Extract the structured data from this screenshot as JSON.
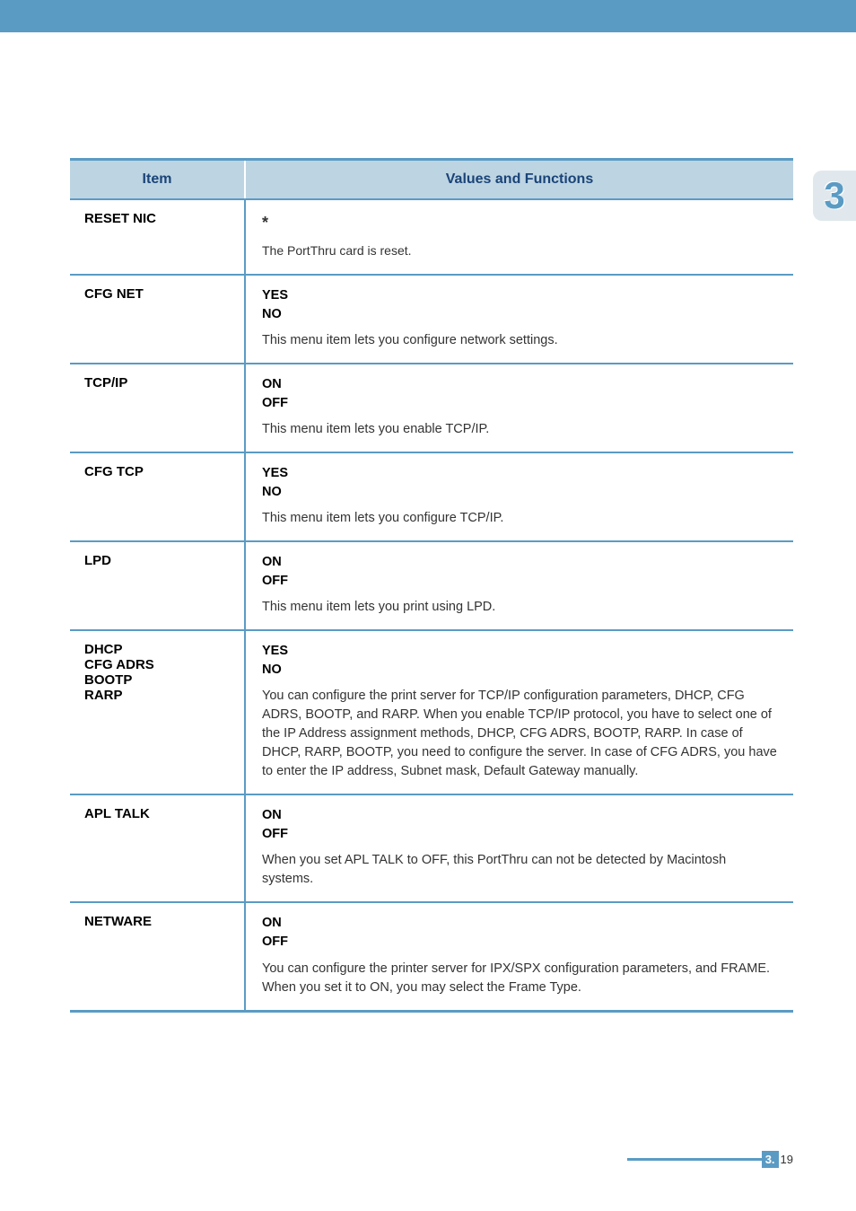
{
  "accent_color": "#5a9bc4",
  "chapter_indicator": "3",
  "table": {
    "headers": {
      "item": "Item",
      "values": "Values and Functions"
    },
    "rows": [
      {
        "item": "RESET NIC",
        "asterisk": "*",
        "description": "The PortThru card is reset."
      },
      {
        "item": "CFG NET",
        "value1": "YES",
        "value2": "NO",
        "description": "This menu item lets you configure network settings."
      },
      {
        "item": "TCP/IP",
        "value1": "ON",
        "value2": "OFF",
        "description": "This menu item lets you enable TCP/IP."
      },
      {
        "item": "CFG TCP",
        "value1": "YES",
        "value2": "NO",
        "description": "This menu item lets you configure TCP/IP."
      },
      {
        "item": "LPD",
        "value1": "ON",
        "value2": "OFF",
        "description": "This menu item lets you print using LPD."
      },
      {
        "item_line1": "DHCP",
        "item_line2": "CFG ADRS",
        "item_line3": "BOOTP",
        "item_line4": "RARP",
        "value1": "YES",
        "value2": "NO",
        "description": "You can configure the print server for TCP/IP configuration parameters, DHCP, CFG ADRS, BOOTP, and RARP. When you enable TCP/IP protocol, you have to select one of the IP Address assignment methods, DHCP, CFG ADRS, BOOTP, RARP. In case of DHCP, RARP, BOOTP, you need to configure the server. In case of CFG ADRS, you have to enter the IP address, Subnet mask, Default Gateway manually."
      },
      {
        "item": "APL TALK",
        "value1": "ON",
        "value2": "OFF",
        "description": "When you set APL TALK to OFF, this PortThru can not be detected by Macintosh systems."
      },
      {
        "item": "NETWARE",
        "value1": "ON",
        "value2": "OFF",
        "description": "You can configure the printer server for IPX/SPX configuration parameters, and FRAME. When you set it to ON, you may select the Frame Type."
      }
    ]
  },
  "footer": {
    "chapter": "3.",
    "page": "19"
  }
}
